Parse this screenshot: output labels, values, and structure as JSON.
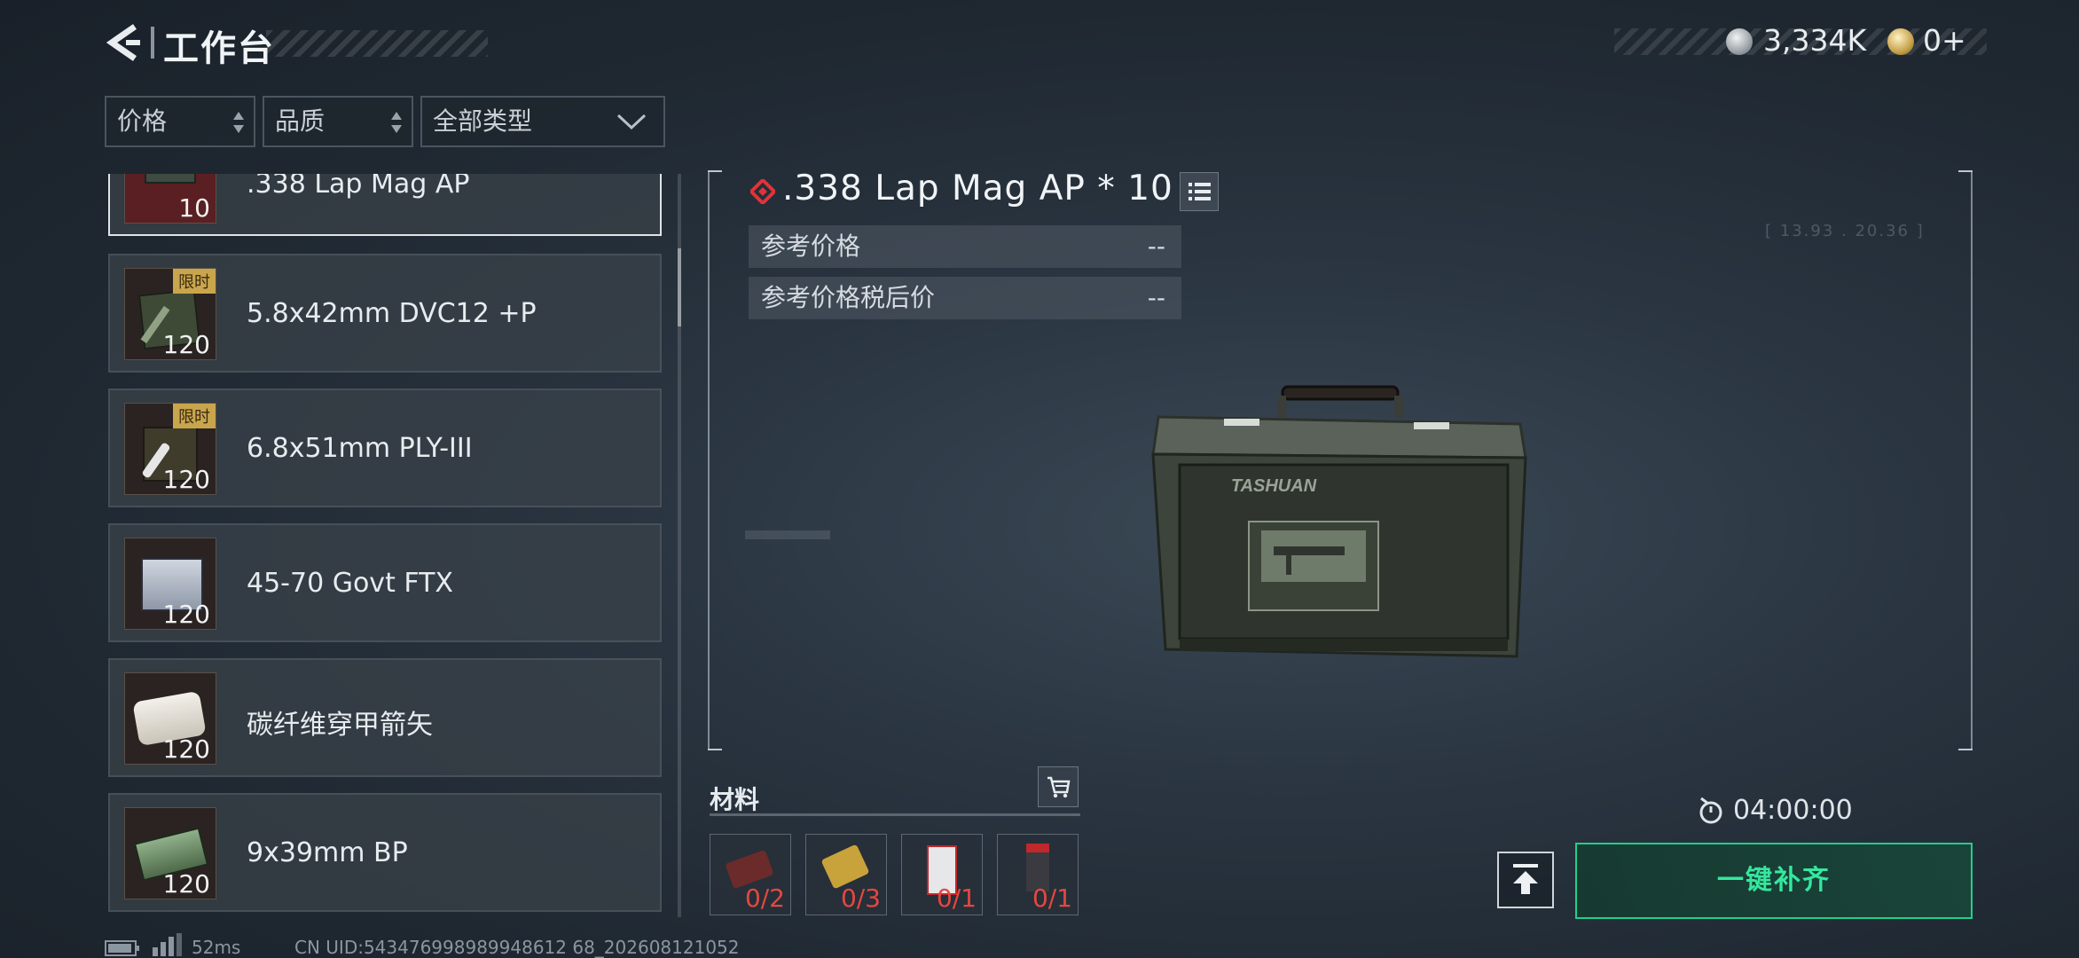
{
  "header": {
    "title": "工作台",
    "currency1": "3,334K",
    "currency2": "0+"
  },
  "filters": {
    "price": "价格",
    "quality": "品质",
    "type": "全部类型"
  },
  "items": [
    {
      "name": ".338 Lap Mag AP",
      "qty": "10",
      "limited": "",
      "selected": true
    },
    {
      "name": "5.8x42mm DVC12 +P",
      "qty": "120",
      "limited": "限时"
    },
    {
      "name": "6.8x51mm PLY-III",
      "qty": "120",
      "limited": "限时"
    },
    {
      "name": "45-70 Govt FTX",
      "qty": "120",
      "limited": ""
    },
    {
      "name": "碳纤维穿甲箭矢",
      "qty": "120",
      "limited": ""
    },
    {
      "name": "9x39mm BP",
      "qty": "120",
      "limited": ""
    }
  ],
  "detail": {
    "title": ".338 Lap Mag AP * 10",
    "ref_price_label": "参考价格",
    "ref_price_value": "--",
    "ref_price_tax_label": "参考价格税后价",
    "ref_price_tax_value": "--",
    "box_brand": "TASHUAN",
    "bg_coords": "[ 13.93 . 20.36 ]"
  },
  "materials": {
    "label": "材料",
    "items": [
      {
        "count": "0/2"
      },
      {
        "count": "0/3"
      },
      {
        "count": "0/1"
      },
      {
        "count": "0/1"
      }
    ]
  },
  "timer": "04:00:00",
  "fill_button": "一键补齐",
  "footer": {
    "ping": "52ms",
    "uid": "CN UID:543476998989948612 68_202608121052"
  },
  "colors": {
    "accent_green": "#1fd08a",
    "missing_red": "#e5473f",
    "limited_gold": "#c9a54c"
  }
}
